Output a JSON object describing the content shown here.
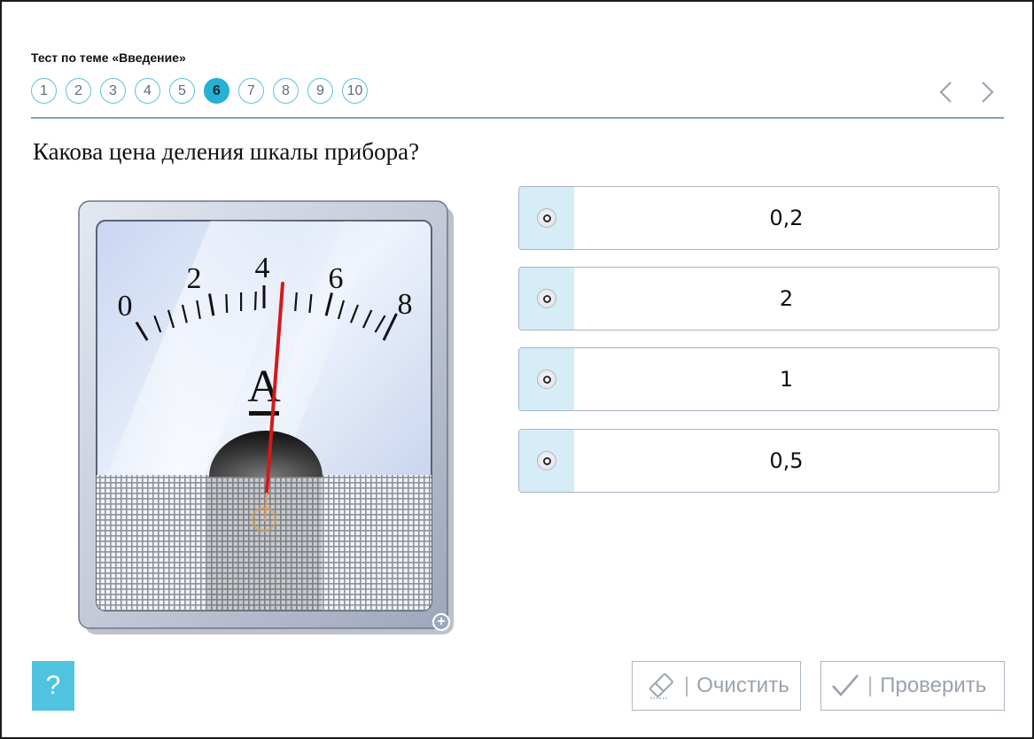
{
  "header": {
    "test_title": "Тест по теме «Введение»",
    "pages": [
      "1",
      "2",
      "3",
      "4",
      "5",
      "6",
      "7",
      "8",
      "9",
      "10"
    ],
    "active_page": "6",
    "prev_icon": "chevron-left-icon",
    "next_icon": "chevron-right-icon"
  },
  "question": {
    "text": "Какова цена деления шкалы прибора?"
  },
  "meter": {
    "scale_labels": [
      "0",
      "2",
      "4",
      "6",
      "8"
    ],
    "unit_label": "A",
    "zoom_icon": "zoom-plus-icon"
  },
  "answers": [
    {
      "label": "0,2"
    },
    {
      "label": "2"
    },
    {
      "label": "1"
    },
    {
      "label": "0,5"
    }
  ],
  "footer": {
    "help_label": "?",
    "clear_label": "Очистить",
    "check_label": "Проверить",
    "clear_icon": "eraser-icon",
    "check_icon": "checkmark-icon"
  },
  "colors": {
    "accent": "#27b0d6",
    "radio_column": "#d6edf7",
    "help_button": "#4fc3e0",
    "needle": "#d21a1a"
  }
}
